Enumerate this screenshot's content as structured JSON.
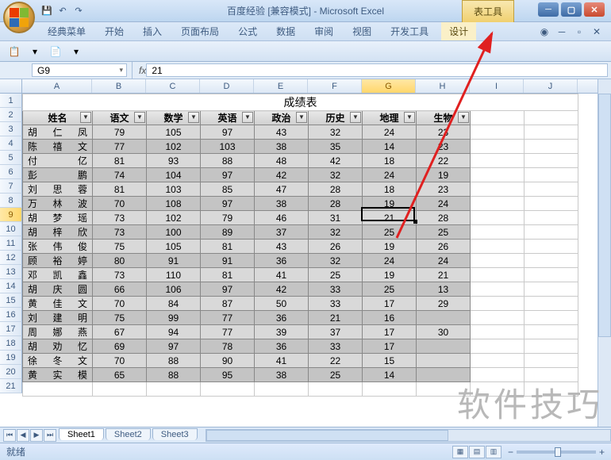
{
  "window": {
    "title": "百度经验  [兼容模式] - Microsoft Excel",
    "tool_tab": "表工具"
  },
  "ribbon": {
    "tabs": [
      "经典菜单",
      "开始",
      "插入",
      "页面布局",
      "公式",
      "数据",
      "审阅",
      "视图",
      "开发工具",
      "设计"
    ]
  },
  "name_box": "G9",
  "formula_fx": "fx",
  "formula_value": "21",
  "columns": [
    "A",
    "B",
    "C",
    "D",
    "E",
    "F",
    "G",
    "H",
    "I",
    "J"
  ],
  "row_count": 21,
  "selected_col": "G",
  "selected_row": 9,
  "title_cell": "成绩表",
  "headers": [
    "姓名",
    "语文",
    "数学",
    "英语",
    "政治",
    "历史",
    "地理",
    "生物"
  ],
  "rows": [
    {
      "name": "胡　仁　凤",
      "v": [
        79,
        105,
        97,
        43,
        32,
        24,
        23
      ]
    },
    {
      "name": "陈　禧　文",
      "v": [
        77,
        102,
        103,
        38,
        35,
        14,
        23
      ]
    },
    {
      "name": "付　　　亿",
      "v": [
        81,
        93,
        88,
        48,
        42,
        18,
        22
      ]
    },
    {
      "name": "彭　　　鹏",
      "v": [
        74,
        104,
        97,
        42,
        32,
        24,
        19
      ]
    },
    {
      "name": "刘　思　蓉",
      "v": [
        81,
        103,
        85,
        47,
        28,
        18,
        23
      ]
    },
    {
      "name": "万　林　波",
      "v": [
        70,
        108,
        97,
        38,
        28,
        19,
        24
      ]
    },
    {
      "name": "胡　梦　瑶",
      "v": [
        73,
        102,
        79,
        46,
        31,
        21,
        28
      ]
    },
    {
      "name": "胡　梓　欣",
      "v": [
        73,
        100,
        89,
        37,
        32,
        25,
        25
      ]
    },
    {
      "name": "张　伟　俊",
      "v": [
        75,
        105,
        81,
        43,
        26,
        19,
        26
      ]
    },
    {
      "name": "顾　裕　婷",
      "v": [
        80,
        91,
        91,
        36,
        32,
        24,
        24
      ]
    },
    {
      "name": "邓　凯　鑫",
      "v": [
        73,
        110,
        81,
        41,
        25,
        19,
        21
      ]
    },
    {
      "name": "胡　庆　圆",
      "v": [
        66,
        106,
        97,
        42,
        33,
        25,
        13
      ]
    },
    {
      "name": "黄　佳　文",
      "v": [
        70,
        84,
        87,
        50,
        33,
        17,
        29
      ]
    },
    {
      "name": "刘　建　明",
      "v": [
        75,
        99,
        77,
        36,
        21,
        16
      ]
    },
    {
      "name": "周　娜　燕",
      "v": [
        67,
        94,
        77,
        39,
        37,
        17,
        30
      ]
    },
    {
      "name": "胡　劝　忆",
      "v": [
        69,
        97,
        78,
        36,
        33,
        17
      ]
    },
    {
      "name": "徐　冬　文",
      "v": [
        70,
        88,
        90,
        41,
        22,
        15
      ]
    },
    {
      "name": "黄　实　模",
      "v": [
        65,
        88,
        95,
        38,
        25,
        14
      ]
    }
  ],
  "sheet_tabs": [
    "Sheet1",
    "Sheet2",
    "Sheet3"
  ],
  "active_sheet": 0,
  "status_text": "就绪",
  "watermark": "软件技巧",
  "chart_data": {
    "type": "table",
    "title": "成绩表",
    "columns": [
      "姓名",
      "语文",
      "数学",
      "英语",
      "政治",
      "历史",
      "地理",
      "生物"
    ],
    "rows": [
      [
        "胡仁凤",
        79,
        105,
        97,
        43,
        32,
        24,
        23
      ],
      [
        "陈禧文",
        77,
        102,
        103,
        38,
        35,
        14,
        23
      ],
      [
        "付亿",
        81,
        93,
        88,
        48,
        42,
        18,
        22
      ],
      [
        "彭鹏",
        74,
        104,
        97,
        42,
        32,
        24,
        19
      ],
      [
        "刘思蓉",
        81,
        103,
        85,
        47,
        28,
        18,
        23
      ],
      [
        "万林波",
        70,
        108,
        97,
        38,
        28,
        19,
        24
      ],
      [
        "胡梦瑶",
        73,
        102,
        79,
        46,
        31,
        21,
        28
      ],
      [
        "胡梓欣",
        73,
        100,
        89,
        37,
        32,
        25,
        25
      ],
      [
        "张伟俊",
        75,
        105,
        81,
        43,
        26,
        19,
        26
      ],
      [
        "顾裕婷",
        80,
        91,
        91,
        36,
        32,
        24,
        24
      ],
      [
        "邓凯鑫",
        73,
        110,
        81,
        41,
        25,
        19,
        21
      ],
      [
        "胡庆圆",
        66,
        106,
        97,
        42,
        33,
        25,
        13
      ],
      [
        "黄佳文",
        70,
        84,
        87,
        50,
        33,
        17,
        29
      ],
      [
        "刘建明",
        75,
        99,
        77,
        36,
        21,
        16,
        null
      ],
      [
        "周娜燕",
        67,
        94,
        77,
        39,
        37,
        17,
        30
      ],
      [
        "胡劝忆",
        69,
        97,
        78,
        36,
        33,
        17,
        null
      ],
      [
        "徐冬文",
        70,
        88,
        90,
        41,
        22,
        15,
        null
      ],
      [
        "黄实模",
        65,
        88,
        95,
        38,
        25,
        14,
        null
      ]
    ]
  }
}
